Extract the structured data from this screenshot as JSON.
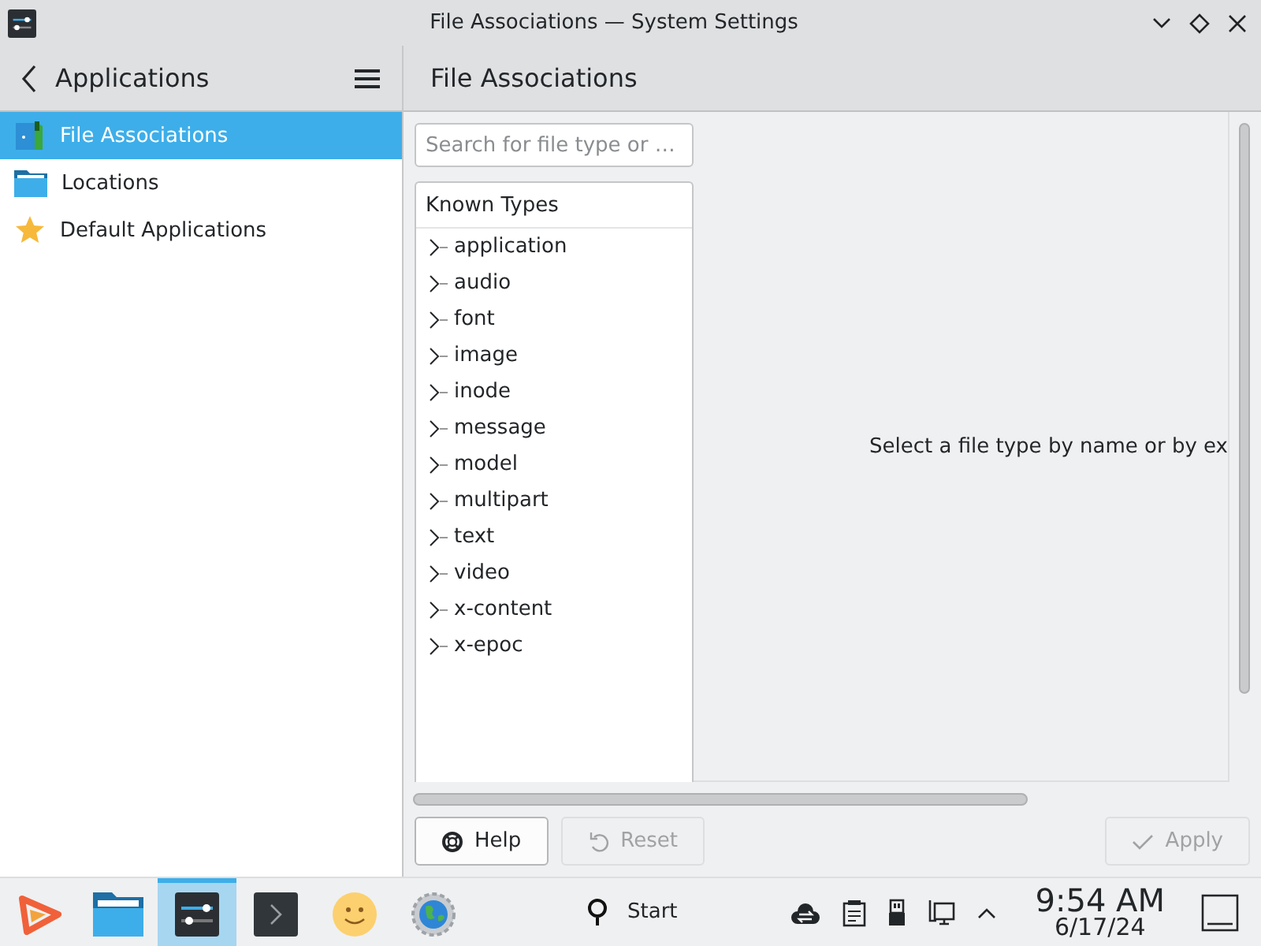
{
  "window": {
    "title": "File Associations — System Settings"
  },
  "sidebar": {
    "title": "Applications",
    "items": [
      {
        "label": "File Associations",
        "kind": "file-assoc",
        "selected": true
      },
      {
        "label": "Locations",
        "kind": "folder",
        "selected": false
      },
      {
        "label": "Default Applications",
        "kind": "star",
        "selected": false
      }
    ]
  },
  "page": {
    "title": "File Associations",
    "search": {
      "placeholder": "Search for file type or …"
    },
    "tree": {
      "header": "Known Types",
      "items": [
        {
          "label": "application",
          "expanded": false
        },
        {
          "label": "audio",
          "expanded": false
        },
        {
          "label": "font",
          "expanded": false
        },
        {
          "label": "image",
          "expanded": false
        },
        {
          "label": "inode",
          "expanded": false
        },
        {
          "label": "message",
          "expanded": false
        },
        {
          "label": "model",
          "expanded": false
        },
        {
          "label": "multipart",
          "expanded": false
        },
        {
          "label": "text",
          "expanded": false
        },
        {
          "label": "video",
          "expanded": false
        },
        {
          "label": "x-content",
          "expanded": false
        },
        {
          "label": "x-epoc",
          "expanded": false
        }
      ]
    },
    "message": "Select a file type by name or by ex",
    "buttons": [
      {
        "label": "Help",
        "kind": "help",
        "disabled": false
      },
      {
        "label": "Reset",
        "kind": "reset",
        "disabled": true
      },
      {
        "label": "Apply",
        "kind": "apply",
        "disabled": true
      }
    ]
  },
  "taskbar": {
    "tasks": [
      {
        "kind": "launcher",
        "selected": false
      },
      {
        "kind": "files",
        "selected": false
      },
      {
        "kind": "settings",
        "selected": true
      },
      {
        "kind": "terminal",
        "selected": false
      },
      {
        "kind": "smiley",
        "selected": false
      },
      {
        "kind": "globe",
        "selected": false
      }
    ],
    "start": "Start",
    "time": "9:54 AM",
    "date": "6/17/24"
  }
}
